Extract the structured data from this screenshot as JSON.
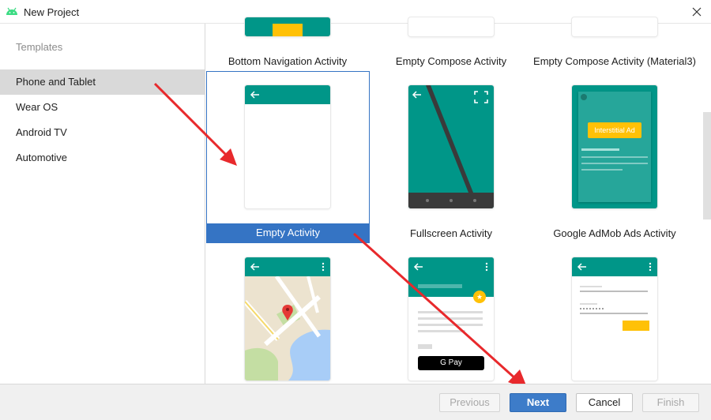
{
  "window": {
    "title": "New Project",
    "icon": "android-icon",
    "close_icon": "close-icon"
  },
  "sidebar": {
    "heading": "Templates",
    "items": [
      {
        "label": "Phone and Tablet",
        "selected": true
      },
      {
        "label": "Wear OS",
        "selected": false
      },
      {
        "label": "Android TV",
        "selected": false
      },
      {
        "label": "Automotive",
        "selected": false
      }
    ]
  },
  "templates": [
    {
      "label": "Bottom Navigation Activity"
    },
    {
      "label": "Empty Compose Activity"
    },
    {
      "label": "Empty Compose Activity (Material3)"
    },
    {
      "label": "Empty Activity",
      "selected": true
    },
    {
      "label": "Fullscreen Activity"
    },
    {
      "label": "Google AdMob Ads Activity"
    },
    {
      "label": "",
      "preview": "map"
    },
    {
      "label": "",
      "preview": "pay"
    },
    {
      "label": "",
      "preview": "login"
    }
  ],
  "previews": {
    "admob_badge": "Interstitial Ad",
    "gpay_label": "G Pay"
  },
  "footer": {
    "previous": "Previous",
    "next": "Next",
    "cancel": "Cancel",
    "finish": "Finish"
  },
  "colors": {
    "accent_teal": "#009688",
    "selection_blue": "#3574c4",
    "annotation_red": "#e8292c",
    "admob_badge": "#ffc107"
  }
}
